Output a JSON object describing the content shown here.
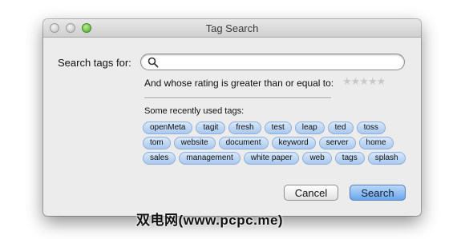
{
  "window": {
    "title": "Tag Search"
  },
  "search": {
    "label": "Search tags for:",
    "value": "",
    "placeholder": ""
  },
  "rating": {
    "label": "And whose rating is greater than or equal to:",
    "stars": "★★★★★",
    "value": 0,
    "max": 5
  },
  "recent": {
    "label": "Some recently used tags:",
    "tags": [
      [
        "openMeta",
        "tagit",
        "fresh",
        "test",
        "leap",
        "ted",
        "toss"
      ],
      [
        "tom",
        "website",
        "document",
        "keyword",
        "server",
        "home"
      ],
      [
        "sales",
        "management",
        "white paper",
        "web",
        "tags",
        "splash"
      ]
    ]
  },
  "buttons": {
    "cancel": "Cancel",
    "search": "Search"
  },
  "watermark": "双电网(www.pcpc.me)",
  "colors": {
    "tag_fill": "#b8d3f3",
    "default_button": "#6aa6ea",
    "window_bg": "#ececec"
  }
}
